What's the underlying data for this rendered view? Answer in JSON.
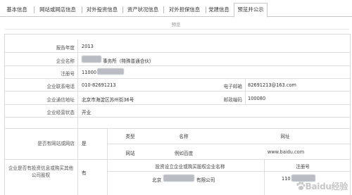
{
  "tabs": [
    {
      "label": "基本信息",
      "active": false
    },
    {
      "label": "网站或网店信息",
      "active": false
    },
    {
      "label": "对外投资信息",
      "active": false
    },
    {
      "label": "资产状况信息",
      "active": false
    },
    {
      "label": "对外担保信息",
      "active": false
    },
    {
      "label": "党建信息",
      "active": false
    },
    {
      "label": "预览并公示",
      "active": true
    }
  ],
  "subtitle": "预览",
  "form": {
    "report_year_label": "报告年度",
    "report_year": "2013",
    "company_name_label": "企业名称",
    "company_name_suffix": "事务所（特殊普通合伙）",
    "reg_no_label": "注册号",
    "reg_no": "11000",
    "phone_label": "企业联系电话",
    "phone": "010-82691213",
    "email_label": "电子邮箱",
    "email": "82691213@163.com",
    "address_label": "企业通信地址",
    "address": "北京市海淀区苏州街36号",
    "zip_label": "邮政编码",
    "zip": "100080",
    "status_label": "企业经营状态",
    "status": "开业",
    "website_question_label": "是否有网站或网店",
    "website_question_value": "是",
    "website_table": {
      "headers": [
        "类型",
        "名称",
        "网址"
      ],
      "rows": [
        [
          "网站",
          "例如百度",
          "www.baidu.com"
        ]
      ]
    },
    "invest_question_label": "企业是否有投资信息或购买其他公司股权",
    "invest_question_value": "有",
    "invest_table": {
      "header_name": "投资设立企业或购买股权企业名称",
      "header_reg": "注册号",
      "row_name_prefix": "北京",
      "row_name_suffix": "有限公司",
      "row_reg_prefix": "110"
    }
  },
  "watermark": "Baidu经验"
}
